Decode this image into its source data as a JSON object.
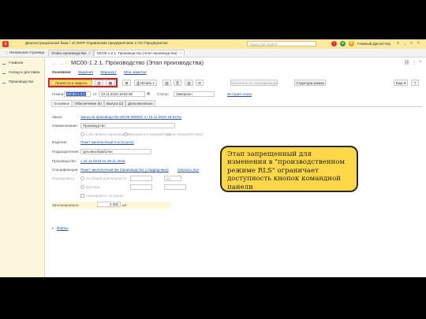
{
  "window": {
    "app_title": "Демонстрационная база / 1С:ERP Управление предприятием 2 /1С:Предприятие",
    "search_placeholder": "Поиск Ctrl+Shift+F",
    "user": "Главный Диспетчер",
    "accent_color": "#fbe9a0"
  },
  "tabs": {
    "home": "Начальная страница",
    "items": [
      {
        "label": "Этапы производства"
      },
      {
        "label": "МС00-1.2.1. Производство (Этап производства)"
      }
    ]
  },
  "sidebar": {
    "items": [
      {
        "label": "Главное",
        "icon": "menu-icon"
      },
      {
        "label": "Склад и доставка",
        "icon": "menu-icon"
      },
      {
        "label": "Производство",
        "icon": "menu-icon"
      }
    ]
  },
  "doc": {
    "title": "МС00-1.2.1. Производство (Этап производства)",
    "links": [
      "Основное",
      "Задания",
      "Маршрут",
      "Мои заметки"
    ]
  },
  "toolbar": {
    "post_close": "Провести и закрыть",
    "print": "Печать",
    "fill_spec": "Заполнить по спецификации",
    "order_structure": "Структура заказа",
    "more": "Еще",
    "help": "?"
  },
  "header_fields": {
    "number_label": "Номер:",
    "number_value": "МС00-1.2.1",
    "date_prefix": "от:",
    "date_value": "23.11.2018 19:02:58",
    "status_label": "Статус:",
    "status_value": "Завершен",
    "history_link": "История этапа"
  },
  "form_tabs": [
    "Основное",
    "Обеспечение (6)",
    "Выпуск (2)",
    "Дополнительно"
  ],
  "fields": [
    {
      "label": "Заказ:",
      "value": "Заказ на производство МС00-000001 от 23.11.2018 18:54:51"
    },
    {
      "label": "Наименование:",
      "value": "Производство"
    },
    {
      "label": "",
      "value": "собственное производство"
    },
    {
      "label": "Изделие:",
      "value": "Пакет заклепочный 3 м (в руло)"
    },
    {
      "label": "Подразделение:",
      "value": "Цех мехобработки"
    },
    {
      "label": "Производство:",
      "value": "с 22.11.2018 по 29.11.2018"
    },
    {
      "label": "Спецификация:",
      "value": "Пакет заклепочный 3м (производство у подрядчика)"
    },
    {
      "label": "Планировать:",
      "value": "по общей длительности"
    },
    {
      "label": "",
      "value": "вручную"
    },
    {
      "label": "",
      "value": "планировать не ранее"
    },
    {
      "label": "Запланировано:",
      "value": "2 000"
    },
    {
      "label": "Файлы",
      "value": ""
    }
  ],
  "extras": {
    "pass_to_processing": "передача в переработку",
    "order_processing": "(заказ переработчику)",
    "show_all": "показать все",
    "days": "дн.",
    "unit": "шт"
  },
  "callout": {
    "text": "Этап запрещенный для изменения в \"производственном режиме RLS\" ограничает доступность кнопок командной панели"
  }
}
